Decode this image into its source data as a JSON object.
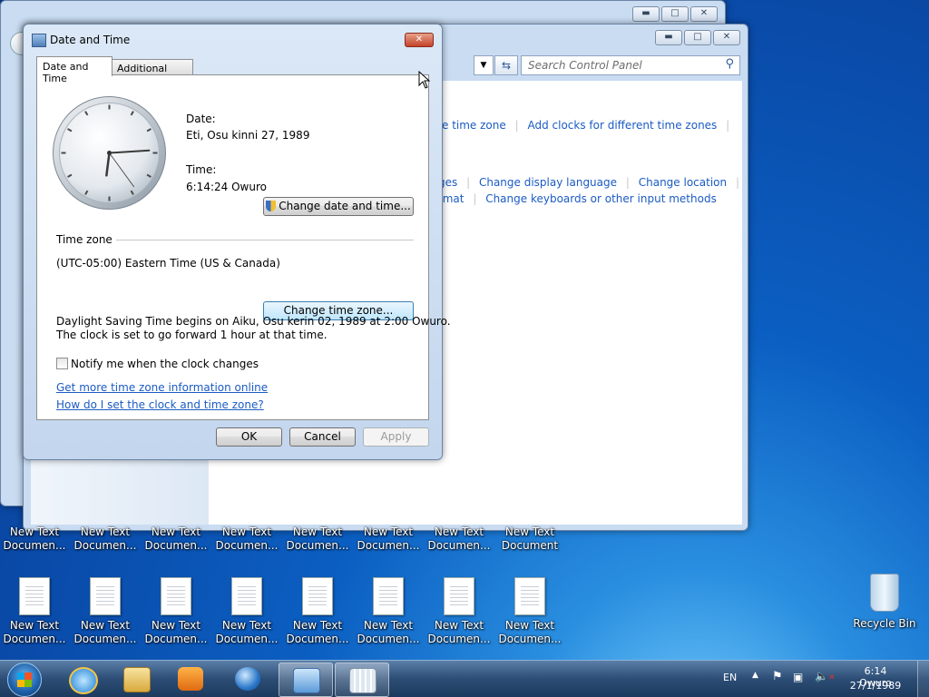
{
  "control_panel": {
    "search_placeholder": "Search Control Panel",
    "links": [
      "e time zone",
      "Add clocks for different time zones",
      "ges",
      "Change display language",
      "Change location",
      "rmat",
      "Change keyboards or other input methods"
    ]
  },
  "dialog": {
    "title": "Date and Time",
    "tabs": [
      "Date and Time",
      "Additional Clocks"
    ],
    "date_label": "Date:",
    "date_value": "Eti, Osu kinni 27, 1989",
    "time_label": "Time:",
    "time_value": "6:14:24 Owuro",
    "change_date_button": "Change date and time...",
    "timezone_header": "Time zone",
    "timezone_value": "(UTC-05:00) Eastern Time (US & Canada)",
    "change_timezone_button": "Change time zone...",
    "dst_line1": "Daylight Saving Time begins on Aiku, Osu kerin 02, 1989 at 2:00 Owuro.",
    "dst_line2": "The clock is set to go forward 1 hour at that time.",
    "notify_label": "Notify me when the clock changes",
    "notify_checked": false,
    "link1": "Get more time zone information online",
    "link2": "How do I set the clock and time zone?",
    "ok": "OK",
    "cancel": "Cancel",
    "apply": "Apply",
    "clock": {
      "hour": 6,
      "minute": 14,
      "second": 24
    }
  },
  "desktop": {
    "row1": [
      {
        "line1": "New Text",
        "line2": "Documen..."
      },
      {
        "line1": "New Text",
        "line2": "Documen..."
      },
      {
        "line1": "New Text",
        "line2": "Documen..."
      },
      {
        "line1": "New Text",
        "line2": "Documen..."
      },
      {
        "line1": "New Text",
        "line2": "Documen..."
      },
      {
        "line1": "New Text",
        "line2": "Documen..."
      },
      {
        "line1": "New Text",
        "line2": "Documen..."
      },
      {
        "line1": "New Text",
        "line2": "Document"
      }
    ],
    "row2": [
      {
        "line1": "New Text",
        "line2": "Documen..."
      },
      {
        "line1": "New Text",
        "line2": "Documen..."
      },
      {
        "line1": "New Text",
        "line2": "Documen..."
      },
      {
        "line1": "New Text",
        "line2": "Documen..."
      },
      {
        "line1": "New Text",
        "line2": "Documen..."
      },
      {
        "line1": "New Text",
        "line2": "Documen..."
      },
      {
        "line1": "New Text",
        "line2": "Documen..."
      },
      {
        "line1": "New Text",
        "line2": "Documen..."
      }
    ],
    "recycle_bin": "Recycle Bin"
  },
  "taskbar": {
    "language": "EN",
    "time": "6:14 Owuro",
    "date": "27/1/1989",
    "apps": [
      "start-orb",
      "internet-explorer",
      "file-explorer",
      "media-player",
      "network-globe",
      "control-panel",
      "date-time"
    ]
  },
  "colors": {
    "link": "#1b5bc4",
    "accent": "#0b5fc2"
  }
}
